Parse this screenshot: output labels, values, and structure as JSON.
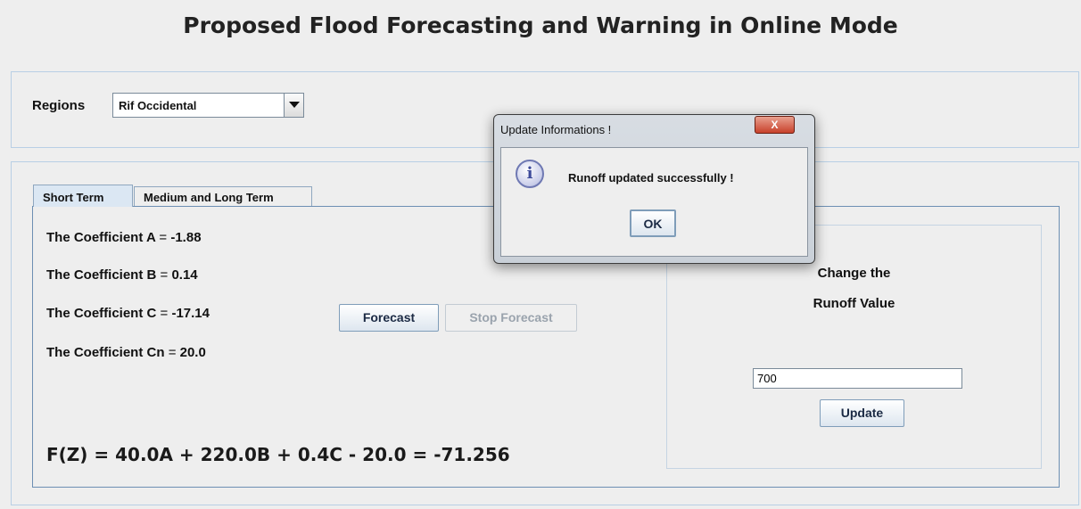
{
  "window": {
    "title": "Proposed Flood Forecasting and Warning in Online Mode"
  },
  "regions": {
    "label": "Regions",
    "selected": "Rif Occidental"
  },
  "tabs": [
    {
      "label": "Short Term"
    },
    {
      "label": "Medium and Long Term"
    }
  ],
  "coefficients": [
    {
      "label": "The Coefficient A",
      "value": "-1.88"
    },
    {
      "label": "The Coefficient B",
      "value": "0.14"
    },
    {
      "label": "The Coefficient C",
      "value": "-17.14"
    },
    {
      "label": "The Coefficient Cn",
      "value": "20.0"
    }
  ],
  "equals": "=",
  "buttons": {
    "forecast": "Forecast",
    "stop_forecast": "Stop Forecast",
    "update": "Update"
  },
  "formula": "F(Z) = 40.0A + 220.0B + 0.4C - 20.0 = -71.256",
  "runoff": {
    "title_line1": "Change the",
    "title_line2": "Runoff Value",
    "input_value": "700"
  },
  "dialog": {
    "title": "Update Informations !",
    "message": "Runoff updated successfully !",
    "ok_label": "OK",
    "close_glyph": "X",
    "icon_glyph": "i",
    "icon": "info-icon"
  }
}
